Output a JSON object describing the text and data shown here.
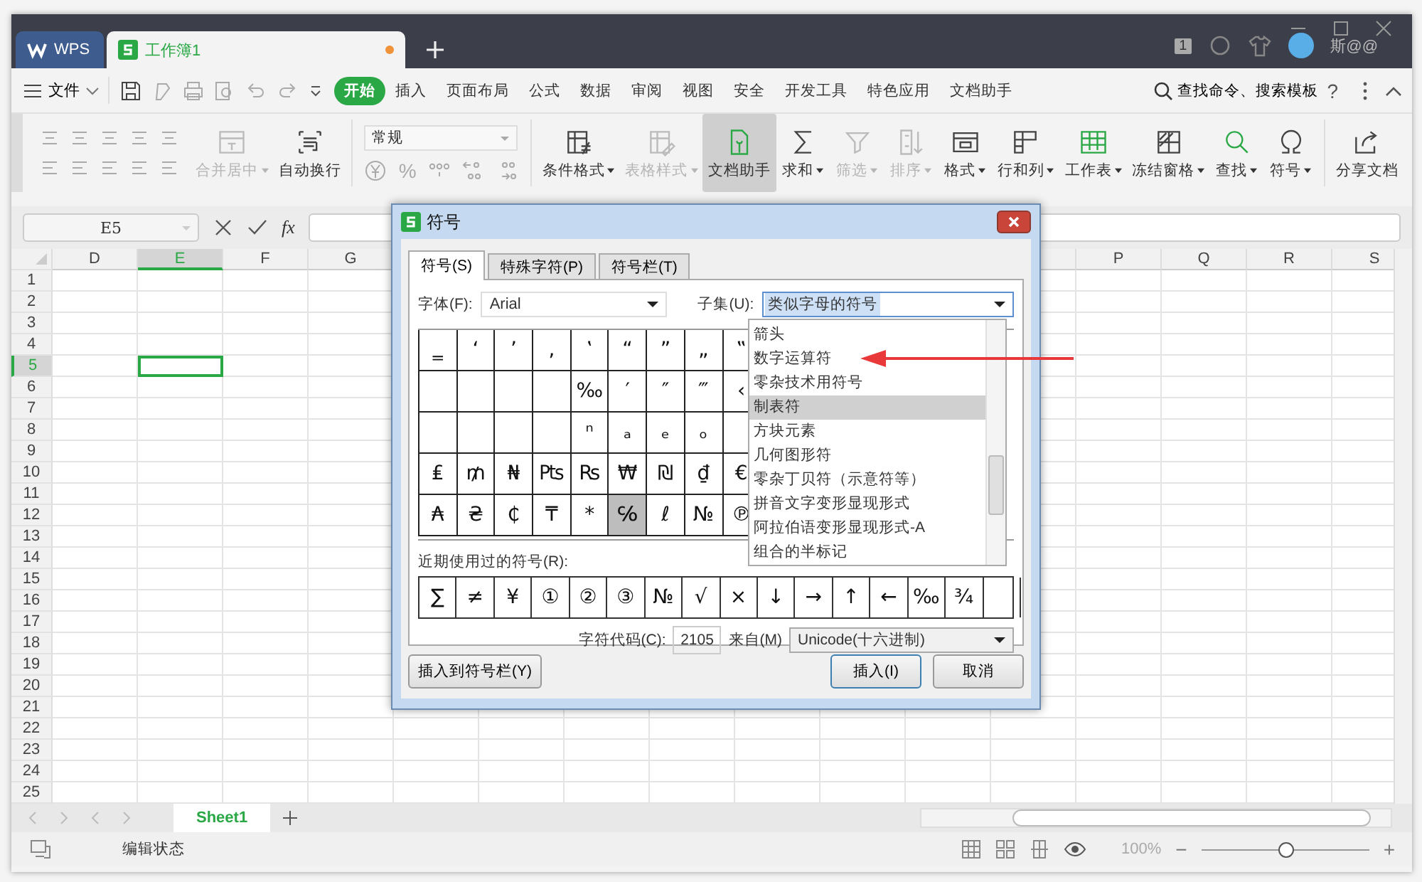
{
  "app_tabs": [
    {
      "label": "WPS",
      "kind": "home",
      "selected": false,
      "unsaved": false
    },
    {
      "label": "工作簿1",
      "kind": "sheet",
      "selected": true,
      "unsaved": true
    }
  ],
  "account": {
    "badge": "1",
    "name": "斯@@"
  },
  "menu": {
    "file": "文件",
    "tabs": [
      {
        "label": "开始",
        "selected": true
      },
      {
        "label": "插入",
        "selected": false
      },
      {
        "label": "页面布局",
        "selected": false
      },
      {
        "label": "公式",
        "selected": false
      },
      {
        "label": "数据",
        "selected": false
      },
      {
        "label": "审阅",
        "selected": false
      },
      {
        "label": "视图",
        "selected": false
      },
      {
        "label": "安全",
        "selected": false
      },
      {
        "label": "开发工具",
        "selected": false
      },
      {
        "label": "特色应用",
        "selected": false
      },
      {
        "label": "文档助手",
        "selected": false
      }
    ],
    "search": "查找命令、搜索模板",
    "help": "?"
  },
  "ribbon": {
    "tools_a": [
      {
        "label": "合并居中",
        "disabled": true,
        "dropdown": true,
        "pressed": false
      },
      {
        "label": "自动换行",
        "disabled": false,
        "dropdown": false,
        "pressed": false
      }
    ],
    "number_format": "常规",
    "percent": "%",
    "tools_b": [
      {
        "label": "条件格式",
        "disabled": false,
        "dropdown": true,
        "pressed": false
      },
      {
        "label": "表格样式",
        "disabled": true,
        "dropdown": true,
        "pressed": false
      },
      {
        "label": "文档助手",
        "disabled": false,
        "dropdown": false,
        "pressed": true
      },
      {
        "label": "求和",
        "disabled": false,
        "dropdown": true,
        "pressed": false
      },
      {
        "label": "筛选",
        "disabled": true,
        "dropdown": true,
        "pressed": false
      },
      {
        "label": "排序",
        "disabled": true,
        "dropdown": true,
        "pressed": false
      },
      {
        "label": "格式",
        "disabled": false,
        "dropdown": true,
        "pressed": false
      },
      {
        "label": "行和列",
        "disabled": false,
        "dropdown": true,
        "pressed": false
      },
      {
        "label": "工作表",
        "disabled": false,
        "dropdown": true,
        "pressed": false
      },
      {
        "label": "冻结窗格",
        "disabled": false,
        "dropdown": true,
        "pressed": false
      },
      {
        "label": "查找",
        "disabled": false,
        "dropdown": true,
        "pressed": false
      },
      {
        "label": "符号",
        "disabled": false,
        "dropdown": true,
        "pressed": false
      },
      {
        "label": "分享文档",
        "disabled": false,
        "dropdown": false,
        "pressed": false
      }
    ]
  },
  "formula_bar": {
    "name_box": "E5",
    "fx": "fx"
  },
  "sheet": {
    "columns_left": [
      {
        "label": "D",
        "selected": false
      },
      {
        "label": "E",
        "selected": true
      },
      {
        "label": "F",
        "selected": false
      },
      {
        "label": "G",
        "selected": false
      }
    ],
    "columns_right": [
      {
        "label": "P",
        "selected": false
      },
      {
        "label": "Q",
        "selected": false
      },
      {
        "label": "R",
        "selected": false
      },
      {
        "label": "S",
        "selected": false
      }
    ],
    "rows": [
      {
        "label": "1",
        "selected": false
      },
      {
        "label": "2",
        "selected": false
      },
      {
        "label": "3",
        "selected": false
      },
      {
        "label": "4",
        "selected": false
      },
      {
        "label": "5",
        "selected": true
      },
      {
        "label": "6",
        "selected": false
      },
      {
        "label": "7",
        "selected": false
      },
      {
        "label": "8",
        "selected": false
      },
      {
        "label": "9",
        "selected": false
      },
      {
        "label": "10",
        "selected": false
      },
      {
        "label": "11",
        "selected": false
      },
      {
        "label": "12",
        "selected": false
      },
      {
        "label": "13",
        "selected": false
      },
      {
        "label": "14",
        "selected": false
      },
      {
        "label": "15",
        "selected": false
      },
      {
        "label": "16",
        "selected": false
      },
      {
        "label": "17",
        "selected": false
      },
      {
        "label": "18",
        "selected": false
      },
      {
        "label": "19",
        "selected": false
      },
      {
        "label": "20",
        "selected": false
      },
      {
        "label": "21",
        "selected": false
      },
      {
        "label": "22",
        "selected": false
      },
      {
        "label": "23",
        "selected": false
      },
      {
        "label": "24",
        "selected": false
      },
      {
        "label": "25",
        "selected": false
      }
    ],
    "sheet_tabs": [
      {
        "label": "Sheet1",
        "selected": true
      }
    ]
  },
  "dialog": {
    "title": "符号",
    "tabs": [
      {
        "label": "符号(S)",
        "selected": true
      },
      {
        "label": "特殊字符(P)",
        "selected": false
      },
      {
        "label": "符号栏(T)",
        "selected": false
      }
    ],
    "font_label": "字体(F):",
    "font": "Arial",
    "subset_label": "子集(U):",
    "subset": "类似字母的符号",
    "subset_options": [
      {
        "label": "箭头",
        "selected": false
      },
      {
        "label": "数字运算符",
        "selected": false
      },
      {
        "label": "零杂技术用符号",
        "selected": false
      },
      {
        "label": "制表符",
        "selected": true
      },
      {
        "label": "方块元素",
        "selected": false
      },
      {
        "label": "几何图形符",
        "selected": false
      },
      {
        "label": "零杂丁贝符（示意符等）",
        "selected": false
      },
      {
        "label": "拼音文字变形显现形式",
        "selected": false
      },
      {
        "label": "阿拉伯语变形显现形式-A",
        "selected": false
      },
      {
        "label": "组合的半标记",
        "selected": false
      }
    ],
    "symbols": [
      [
        {
          "char": "‗",
          "selected": false
        },
        {
          "char": "‘",
          "selected": false
        },
        {
          "char": "’",
          "selected": false
        },
        {
          "char": "‚",
          "selected": false
        },
        {
          "char": "‛",
          "selected": false
        },
        {
          "char": "“",
          "selected": false
        },
        {
          "char": "”",
          "selected": false
        },
        {
          "char": "„",
          "selected": false
        },
        {
          "char": "‟",
          "selected": false
        }
      ],
      [
        {
          "selected": false
        },
        {
          "selected": false
        },
        {
          "selected": false
        },
        {
          "selected": false
        },
        {
          "char": "‰",
          "selected": false
        },
        {
          "char": "′",
          "selected": false
        },
        {
          "char": "″",
          "selected": false
        },
        {
          "char": "‴",
          "selected": false
        },
        {
          "char": "‹",
          "selected": false
        }
      ],
      [
        {
          "selected": false
        },
        {
          "selected": false
        },
        {
          "selected": false
        },
        {
          "selected": false
        },
        {
          "char": "ⁿ",
          "selected": false
        },
        {
          "char": "ₐ",
          "selected": false
        },
        {
          "char": "ₑ",
          "selected": false
        },
        {
          "char": "ₒ",
          "selected": false
        },
        {
          "selected": false
        }
      ],
      [
        {
          "char": "₤",
          "selected": false
        },
        {
          "char": "₥",
          "selected": false
        },
        {
          "char": "₦",
          "selected": false
        },
        {
          "char": "₧",
          "selected": false
        },
        {
          "char": "₨",
          "selected": false
        },
        {
          "char": "₩",
          "selected": false
        },
        {
          "char": "₪",
          "selected": false
        },
        {
          "char": "₫",
          "selected": false
        },
        {
          "char": "€",
          "selected": false
        }
      ],
      [
        {
          "char": "₳",
          "selected": false
        },
        {
          "char": "₴",
          "selected": false
        },
        {
          "char": "₵",
          "selected": false
        },
        {
          "char": "₸",
          "selected": false
        },
        {
          "char": "*",
          "selected": false
        },
        {
          "char": "℅",
          "selected": true
        },
        {
          "char": "ℓ",
          "selected": false
        },
        {
          "char": "№",
          "selected": false
        },
        {
          "char": "℗",
          "selected": false
        }
      ]
    ],
    "recent_label": "近期使用过的符号(R):",
    "recent": [
      "∑",
      "≠",
      "¥",
      "①",
      "②",
      "③",
      "№",
      "√",
      "×",
      "↓",
      "→",
      "↑",
      "←",
      "‰",
      "¾"
    ],
    "code_label": "字符代码(C):",
    "code": "2105",
    "from_label": "来自(M)",
    "from": "Unicode(十六进制)",
    "buttons": [
      "插入到符号栏(Y)",
      "插入(I)",
      "取消"
    ]
  },
  "status": {
    "mode": "编辑状态",
    "zoom": "100%",
    "zoom_slider": {
      "level": 0.5
    },
    "minus": "−",
    "plus": "+"
  }
}
